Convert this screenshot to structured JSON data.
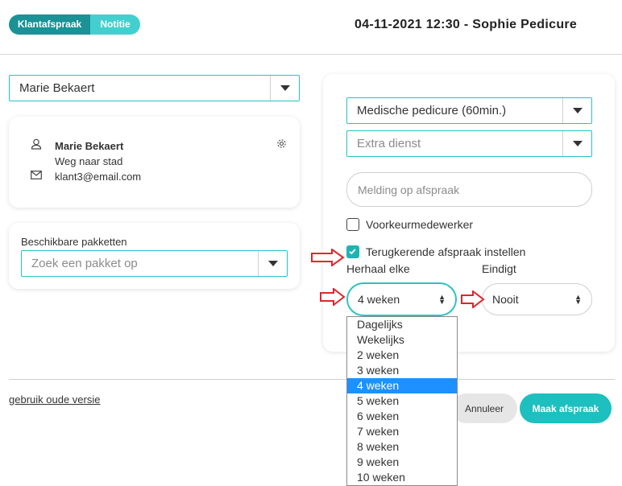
{
  "header": {
    "tabs": [
      {
        "label": "Klantafspraak",
        "active": true
      },
      {
        "label": "Notitie",
        "active": false
      }
    ],
    "title": "04-11-2021 12:30 - Sophie Pedicure"
  },
  "client": {
    "select_value": "Marie Bekaert",
    "name": "Marie Bekaert",
    "address": "Weg naar stad",
    "email": "klant3@email.com"
  },
  "packages": {
    "label": "Beschikbare pakketten",
    "placeholder": "Zoek een pakket op"
  },
  "appointment": {
    "service": "Medische pedicure (60min.)",
    "extra_placeholder": "Extra dienst",
    "note_placeholder": "Melding op afspraak",
    "preferred_label": "Voorkeurmedewerker",
    "recurring_label": "Terugkerende afspraak instellen",
    "repeat_label": "Herhaal elke",
    "repeat_value": "4 weken",
    "ends_label": "Eindigt",
    "ends_value": "Nooit"
  },
  "repeat_options": [
    "Dagelijks",
    "Wekelijks",
    "2 weken",
    "3 weken",
    "4 weken",
    "5 weken",
    "6 weken",
    "7 weken",
    "8 weken",
    "9 weken",
    "10 weken"
  ],
  "footer": {
    "old_version_link": "gebruik oude versie",
    "cancel_label": "Annuleer",
    "submit_label": "Maak afspraak"
  },
  "colors": {
    "accent": "#1ebfbf",
    "accent_dark": "#1a9296",
    "highlight": "#1e90ff",
    "annotation_arrow": "#e0262b"
  }
}
